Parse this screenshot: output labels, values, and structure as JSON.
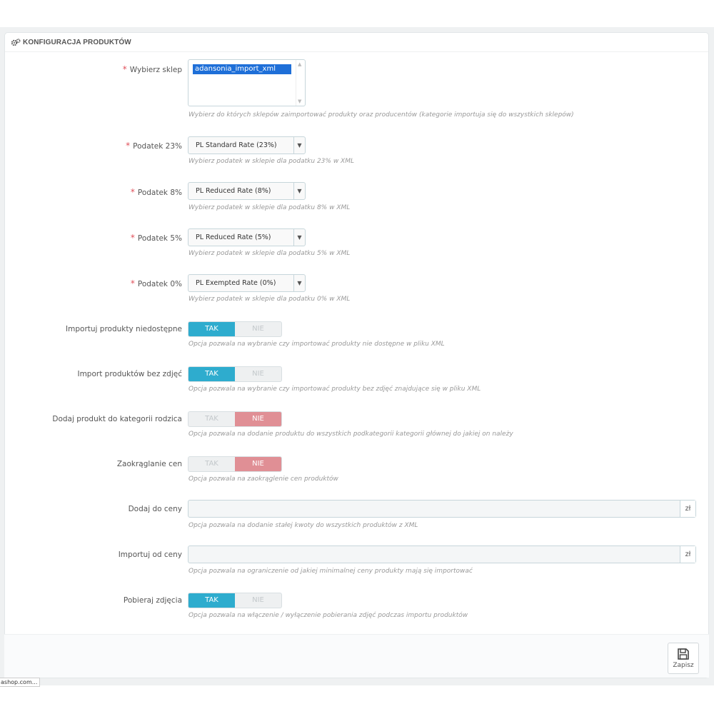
{
  "panel": {
    "title": "KONFIGURACJA PRODUKTÓW",
    "icon": "cogs-icon"
  },
  "fields": {
    "shop": {
      "required": "*",
      "label": "Wybierz sklep",
      "selected_option": "adansonia_import_xml",
      "help": "Wybierz do których sklepów zaimportować produkty oraz producentów (kategorie importuja się do wszystkich sklepów)"
    },
    "tax23": {
      "required": "*",
      "label": "Podatek 23%",
      "value": "PL Standard Rate (23%)",
      "help": "Wybierz podatek w sklepie dla podatku 23% w XML"
    },
    "tax8": {
      "required": "*",
      "label": "Podatek 8%",
      "value": "PL Reduced Rate (8%)",
      "help": "Wybierz podatek w sklepie dla podatku 8% w XML"
    },
    "tax5": {
      "required": "*",
      "label": "Podatek 5%",
      "value": "PL Reduced Rate (5%)",
      "help": "Wybierz podatek w sklepie dla podatku 5% w XML"
    },
    "tax0": {
      "required": "*",
      "label": "Podatek 0%",
      "value": "PL Exempted Rate (0%)",
      "help": "Wybierz podatek w sklepie dla podatku 0% w XML"
    },
    "import_unavailable": {
      "label": "Importuj produkty niedostępne",
      "yes": "TAK",
      "no": "NIE",
      "selected": "yes",
      "help": "Opcja pozwala na wybranie czy importować produkty nie dostępne w pliku XML"
    },
    "import_no_images": {
      "label": "Import produktów bez zdjęć",
      "yes": "TAK",
      "no": "NIE",
      "selected": "yes",
      "help": "Opcja pozwala na wybranie czy importować produkty bez zdjęć znajdujące się w pliku XML"
    },
    "add_parent_category": {
      "label": "Dodaj produkt do kategorii rodzica",
      "yes": "TAK",
      "no": "NIE",
      "selected": "no",
      "help": "Opcja pozwala na dodanie produktu do wszystkich podkategorii kategorii głównej do jakiej on należy"
    },
    "round_prices": {
      "label": "Zaokrąglanie cen",
      "yes": "TAK",
      "no": "NIE",
      "selected": "no",
      "help": "Opcja pozwala na zaokrąglenie cen produktów"
    },
    "add_to_price": {
      "label": "Dodaj do ceny",
      "value": "",
      "suffix": "zł",
      "help": "Opcja pozwala na dodanie stałej kwoty do wszystkich produktów z XML"
    },
    "import_from_price": {
      "label": "Importuj od ceny",
      "value": "",
      "suffix": "zł",
      "help": "Opcja pozwala na ograniczenie od jakiej minimalnej ceny produkty mają się importować"
    },
    "download_images": {
      "label": "Pobieraj zdjęcia",
      "yes": "TAK",
      "no": "NIE",
      "selected": "yes",
      "help": "Opcja pozwala na włączenie / wyłączenie pobierania zdjęć podczas importu produktów"
    }
  },
  "footer": {
    "save_label": "Zapisz",
    "save_icon": "floppy-disk-icon"
  },
  "statusbar": {
    "text": "ashop.com..."
  },
  "colors": {
    "toggle_yes": "#2eacce",
    "toggle_no": "#e08f95",
    "required": "#e0505a",
    "selected_option": "#1e6fd8"
  }
}
